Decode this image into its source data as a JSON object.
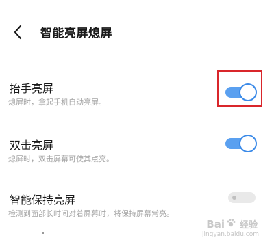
{
  "header": {
    "back_icon": "chevron-left-icon",
    "title": "智能亮屏熄屏"
  },
  "settings": [
    {
      "title": "抬手亮屏",
      "description": "熄屏时，拿起手机自动亮屏。",
      "enabled": true
    },
    {
      "title": "双击亮屏",
      "description": "熄屏时，双击屏幕可使其点亮。",
      "enabled": true
    },
    {
      "title": "智能保持亮屏",
      "description": "检测到面部长时间对着屏幕时，将保持屏幕常亮。",
      "enabled": false
    }
  ],
  "colors": {
    "toggle_on": "#5aa0f0",
    "toggle_off": "#e9e9e9",
    "highlight": "#d9262b"
  },
  "watermark": {
    "brand_left": "Bai",
    "brand_right": "经验",
    "url": "jingyan.baidu.com"
  }
}
